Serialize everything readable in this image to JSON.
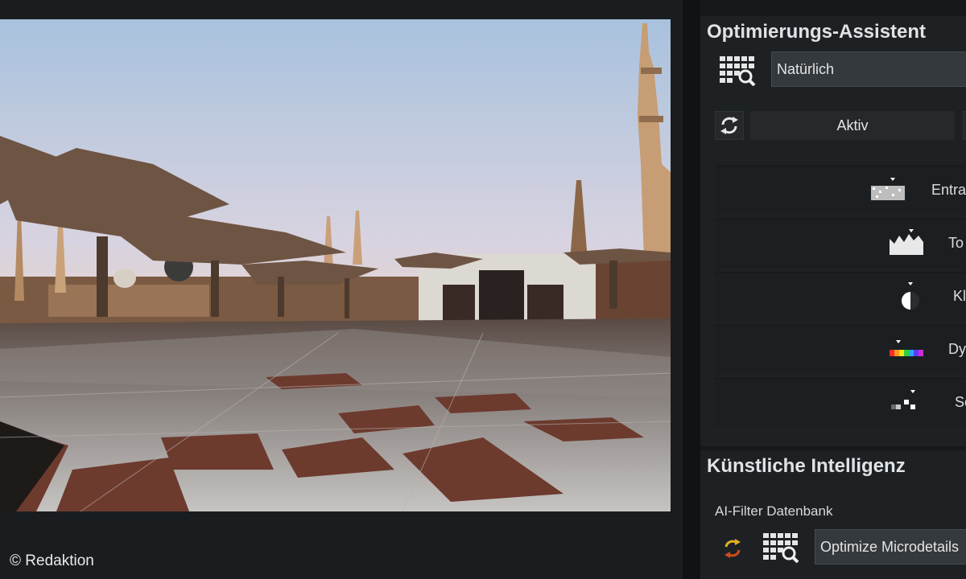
{
  "credit": "© Redaktion",
  "optimization": {
    "title": "Optimierungs-Assistent",
    "preset_value": "Natürlich",
    "active_label": "Aktiv",
    "rows": [
      {
        "label": "Entra",
        "icon": "noise-texture-icon"
      },
      {
        "label": "To",
        "icon": "tone-curve-icon"
      },
      {
        "label": "Kl",
        "icon": "contrast-half-circle-icon"
      },
      {
        "label": "Dy",
        "icon": "color-spectrum-icon"
      },
      {
        "label": "Sc",
        "icon": "sharpness-steps-icon"
      }
    ]
  },
  "ai": {
    "title": "Künstliche Intelligenz",
    "db_label": "AI-Filter Datenbank",
    "filter_value": "Optimize Microdetails"
  },
  "colors": {
    "panel_bg": "#1e2124",
    "accent_yellow": "#e0b020",
    "accent_red": "#d04a1c"
  }
}
